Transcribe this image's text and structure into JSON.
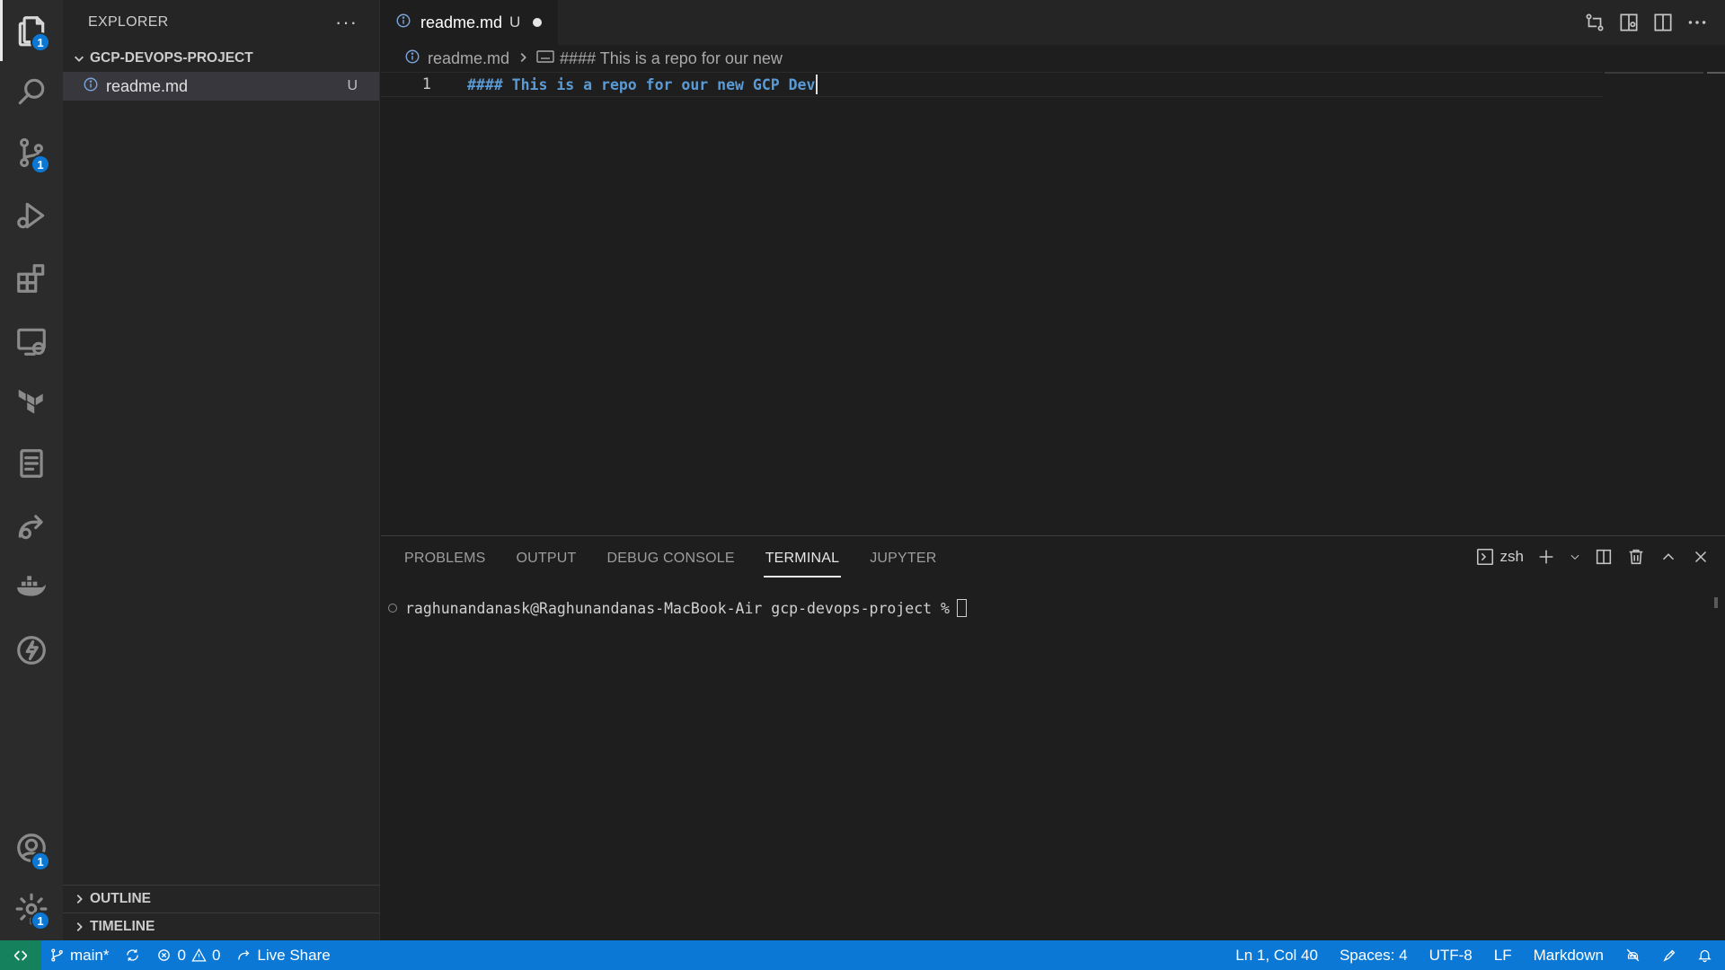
{
  "activity_bar": {
    "items": [
      {
        "name": "explorer",
        "icon": "files-icon",
        "badge": "1"
      },
      {
        "name": "search",
        "icon": "search-icon",
        "badge": ""
      },
      {
        "name": "source-control",
        "icon": "source-control-icon",
        "badge": "1"
      },
      {
        "name": "run-debug",
        "icon": "run-debug-icon",
        "badge": ""
      },
      {
        "name": "extensions",
        "icon": "extensions-icon",
        "badge": ""
      },
      {
        "name": "remote-explorer",
        "icon": "remote-explorer-icon",
        "badge": ""
      },
      {
        "name": "terraform",
        "icon": "terraform-icon",
        "badge": ""
      },
      {
        "name": "notebook",
        "icon": "notebook-icon",
        "badge": ""
      },
      {
        "name": "live-share",
        "icon": "live-share-icon",
        "badge": ""
      },
      {
        "name": "docker",
        "icon": "docker-icon",
        "badge": ""
      },
      {
        "name": "thunder",
        "icon": "lightning-icon",
        "badge": ""
      }
    ],
    "accounts_badge": "1",
    "settings_badge": "1"
  },
  "sidebar": {
    "title": "EXPLORER",
    "more": "···",
    "folder": "GCP-DEVOPS-PROJECT",
    "files": [
      {
        "name": "readme.md",
        "status": "U"
      }
    ],
    "outline_label": "OUTLINE",
    "timeline_label": "TIMELINE"
  },
  "editor": {
    "tab": {
      "name": "readme.md",
      "status": "U"
    },
    "breadcrumb": {
      "file": "readme.md",
      "symbol": "#### This is a repo for our new"
    },
    "lines": [
      {
        "number": "1",
        "text": "#### This is a repo for our new GCP Dev"
      }
    ]
  },
  "panel": {
    "tabs": [
      "PROBLEMS",
      "OUTPUT",
      "DEBUG CONSOLE",
      "TERMINAL",
      "JUPYTER"
    ],
    "active_tab": "TERMINAL",
    "shell": "zsh",
    "terminal_prompt": "raghunandanask@Raghunandanas-MacBook-Air gcp-devops-project %"
  },
  "status_bar": {
    "branch": "main*",
    "errors": "0",
    "warnings": "0",
    "live_share": "Live Share",
    "position": "Ln 1, Col 40",
    "spaces": "Spaces: 4",
    "encoding": "UTF-8",
    "eol": "LF",
    "language": "Markdown"
  },
  "colors": {
    "accent": "#0a78d4",
    "remote": "#16825d",
    "heading_code": "#5b9bd5"
  }
}
